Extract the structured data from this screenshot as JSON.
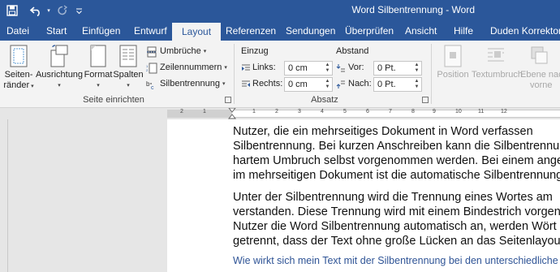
{
  "window": {
    "title": "Word Silbentrennung  -  Word"
  },
  "qat": {
    "save_icon": "save-icon",
    "undo_icon": "undo-icon",
    "redo_icon": "redo-icon",
    "customize_icon": "customize-qat-icon"
  },
  "tabs": [
    "Datei",
    "Start",
    "Einfügen",
    "Entwurf",
    "Layout",
    "Referenzen",
    "Sendungen",
    "Überprüfen",
    "Ansicht",
    "Hilfe",
    "Duden Korrektor"
  ],
  "active_tab": "Layout",
  "ribbon": {
    "seite_einrichten": {
      "label": "Seite einrichten",
      "seitenraender": [
        "Seiten-",
        "ränder"
      ],
      "ausrichtung": "Ausrichtung",
      "format": "Format",
      "spalten": "Spalten",
      "umbrueche": "Umbrüche",
      "zeilennummern": "Zeilennummern",
      "silbentrennung": "Silbentrennung"
    },
    "absatz": {
      "label": "Absatz",
      "einzug": "Einzug",
      "abstand": "Abstand",
      "links_label": "Links:",
      "links_value": "0 cm",
      "rechts_label": "Rechts:",
      "rechts_value": "0 cm",
      "vor_label": "Vor:",
      "vor_value": "0 Pt.",
      "nach_label": "Nach:",
      "nach_value": "0 Pt."
    },
    "anordnen": {
      "position": "Position",
      "textumbruch": "Textumbruch",
      "ebene_nach_vorne": [
        "Ebene nach",
        "vorne"
      ]
    }
  },
  "ruler": {
    "numbers": [
      "2",
      "1",
      "1",
      "2",
      "3",
      "4",
      "5",
      "6",
      "7",
      "8",
      "9",
      "10",
      "11",
      "12"
    ]
  },
  "document": {
    "paragraph1": [
      "Nutzer, die ein mehrseitiges Dokument in Word verfassen",
      "Silbentrennung. Bei kurzen Anschreiben kann die Silbentrennung",
      "hartem Umbruch selbst vorgenommen werden. Bei einem angepa",
      "im mehrseitigen Dokument ist die automatische Silbentrennung ein"
    ],
    "paragraph2": [
      "Unter der Silbentrennung wird die Trennung eines Wortes am",
      "verstanden. Diese Trennung wird mit einem Bindestrich vorgen",
      "Nutzer die Word Silbentrennung automatisch an, werden Wört",
      "getrennt, dass der Text ohne große Lücken an das Seitenlayout an"
    ],
    "heading": "Wie wirkt sich mein Text mit der Silbentrennung bei den unterschiedliche"
  },
  "colors": {
    "word_blue": "#2b579a",
    "ribbon_bg": "#f3f3f3",
    "heading_blue": "#2f5496"
  }
}
